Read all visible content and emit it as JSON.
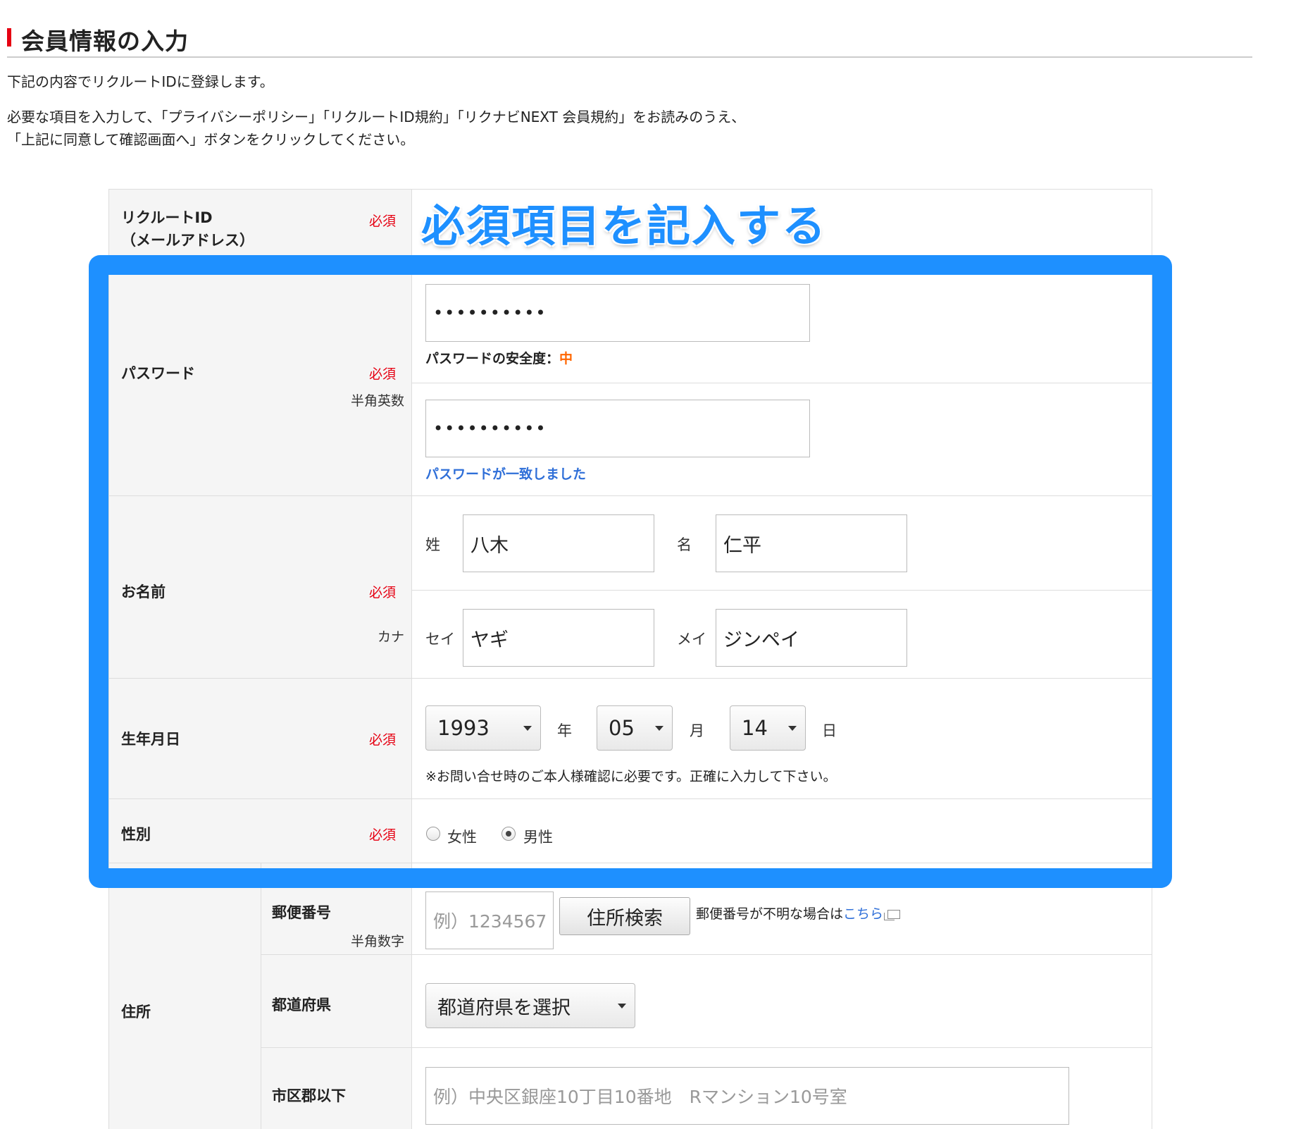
{
  "page": {
    "title": "会員情報の入力",
    "intro1": "下記の内容でリクルートIDに登録します。",
    "intro2a": "必要な項目を入力して、「プライバシーポリシー」「リクルートID規約」「リクナビNEXT 会員規約」をお読みのうえ、",
    "intro2b": "「上記に同意して確認画面へ」ボタンをクリックしてください。"
  },
  "annotation": "必須項目を記入する",
  "required_label": "必須",
  "colors": {
    "accent": "#e60012",
    "highlight": "#1e90ff",
    "strength": "#ff6600",
    "link": "#2f6fd8"
  },
  "form": {
    "recruit_id": {
      "label_line1": "リクルートID",
      "label_line2": "（メールアドレス）"
    },
    "password": {
      "label": "パスワード",
      "sub": "半角英数",
      "value1": "••••••••••",
      "strength_label": "パスワードの安全度：",
      "strength_value": "中",
      "value2": "••••••••••",
      "match_message": "パスワードが一致しました"
    },
    "name": {
      "label": "お名前",
      "kana_label": "カナ",
      "sei_label": "姓",
      "sei_value": "八木",
      "mei_label": "名",
      "mei_value": "仁平",
      "sei_kana_label": "セイ",
      "sei_kana_value": "ヤギ",
      "mei_kana_label": "メイ",
      "mei_kana_value": "ジンペイ"
    },
    "birthday": {
      "label": "生年月日",
      "year": "1993",
      "year_unit": "年",
      "month": "05",
      "month_unit": "月",
      "day": "14",
      "day_unit": "日",
      "note": "※お問い合せ時のご本人様確認に必要です。正確に入力して下さい。"
    },
    "gender": {
      "label": "性別",
      "options": [
        "女性",
        "男性"
      ],
      "selected": "男性"
    },
    "address": {
      "label": "住所",
      "postal_label": "郵便番号",
      "postal_sub": "半角数字",
      "postal_placeholder": "例）1234567",
      "search_button": "住所検索",
      "postal_help": "郵便番号が不明な場合は",
      "postal_help_link": "こちら",
      "pref_label": "都道府県",
      "pref_value": "都道府県を選択",
      "city_label": "市区郡以下",
      "city_placeholder": "例）中央区銀座10丁目10番地　Rマンション10号室"
    }
  }
}
